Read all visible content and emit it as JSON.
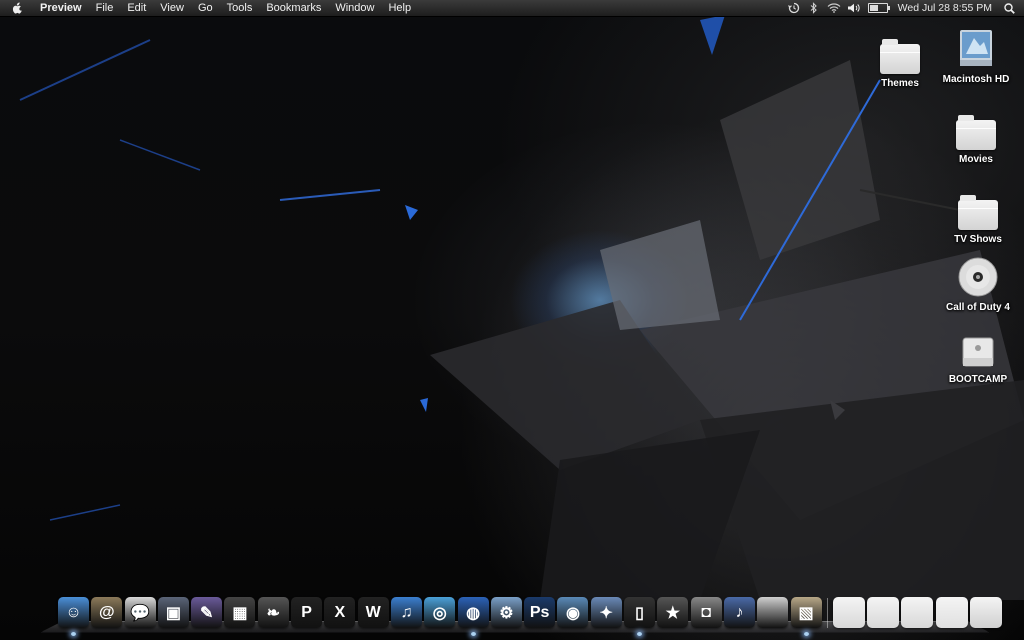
{
  "menubar": {
    "app_name": "Preview",
    "menus": [
      "File",
      "Edit",
      "View",
      "Go",
      "Tools",
      "Bookmarks",
      "Window",
      "Help"
    ],
    "clock": "Wed Jul 28  8:55 PM",
    "battery_level": 0.55
  },
  "desktop_icons": [
    {
      "label": "Themes",
      "icon": "folder-icon"
    },
    {
      "label": "Macintosh HD",
      "icon": "hard-drive-icon"
    },
    {
      "label": "Movies",
      "icon": "folder-icon"
    },
    {
      "label": "TV Shows",
      "icon": "folder-icon"
    },
    {
      "label": "Call of Duty 4",
      "icon": "dvd-icon"
    },
    {
      "label": "BOOTCAMP",
      "icon": "external-drive-icon"
    }
  ],
  "dock": {
    "apps": [
      {
        "name": "finder-icon",
        "glyph": "☺",
        "color": "#4a8fd8",
        "running": true
      },
      {
        "name": "address-book-icon",
        "glyph": "@",
        "color": "#8c7a5a",
        "running": false
      },
      {
        "name": "ichat-icon",
        "glyph": "💬",
        "color": "#d8d8d8",
        "running": false
      },
      {
        "name": "keynote-icon",
        "glyph": "▣",
        "color": "#5a6478",
        "running": false
      },
      {
        "name": "quill-icon",
        "glyph": "✎",
        "color": "#6a5a9a",
        "running": false
      },
      {
        "name": "clapper-icon",
        "glyph": "▦",
        "color": "#444444",
        "running": false
      },
      {
        "name": "script-icon",
        "glyph": "❧",
        "color": "#555555",
        "running": false
      },
      {
        "name": "letter-p-icon",
        "glyph": "P",
        "color": "#222222",
        "running": false
      },
      {
        "name": "letter-x-icon",
        "glyph": "X",
        "color": "#222222",
        "running": false
      },
      {
        "name": "letter-w-icon",
        "glyph": "W",
        "color": "#222222",
        "running": false
      },
      {
        "name": "itunes-icon",
        "glyph": "♫",
        "color": "#3b7fd0",
        "running": false
      },
      {
        "name": "safari-icon",
        "glyph": "◎",
        "color": "#4aa0d8",
        "running": false
      },
      {
        "name": "firefox-icon",
        "glyph": "◍",
        "color": "#2b62b8",
        "running": true
      },
      {
        "name": "utility-icon",
        "glyph": "⚙",
        "color": "#7aa0c8",
        "running": false
      },
      {
        "name": "photoshop-icon",
        "glyph": "Ps",
        "color": "#1a3a6a",
        "running": false
      },
      {
        "name": "network-icon",
        "glyph": "◉",
        "color": "#5a8ab8",
        "running": false
      },
      {
        "name": "system-icon",
        "glyph": "✦",
        "color": "#6a8ab8",
        "running": false
      },
      {
        "name": "phone-icon",
        "glyph": "▯",
        "color": "#333333",
        "running": true
      },
      {
        "name": "imovie-icon",
        "glyph": "★",
        "color": "#555555",
        "running": false
      },
      {
        "name": "camera-icon",
        "glyph": "◘",
        "color": "#888888",
        "running": false
      },
      {
        "name": "guitar-icon",
        "glyph": "♪",
        "color": "#4a6aa8",
        "running": false
      },
      {
        "name": "apple-icon",
        "glyph": "",
        "color": "#cfcfcf",
        "running": false
      },
      {
        "name": "preview-icon",
        "glyph": "▧",
        "color": "#b8a888",
        "running": true
      }
    ],
    "stacks": [
      {
        "name": "applications-stack-icon",
        "color": "#d8d8d8"
      },
      {
        "name": "documents-stack-icon",
        "color": "#d8d8d8"
      },
      {
        "name": "downloads-stack-icon",
        "color": "#d8d8d8"
      },
      {
        "name": "mail-stack-icon",
        "color": "#e0e0e0"
      },
      {
        "name": "trash-icon",
        "color": "#d0d0d0"
      }
    ]
  }
}
